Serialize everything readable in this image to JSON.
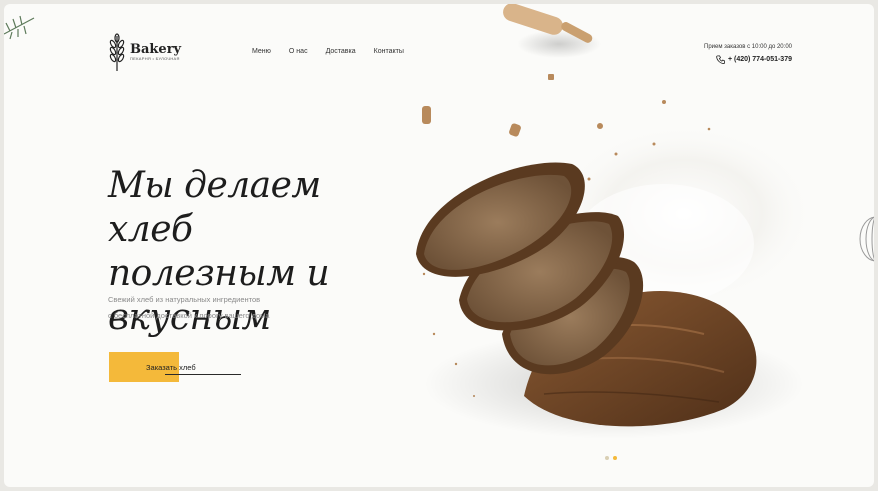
{
  "brand": {
    "name": "Bakery",
    "tagline": "ПЕКАРНЯ • БУЛОЧНАЯ"
  },
  "nav": {
    "items": [
      "Меню",
      "О нас",
      "Доставка",
      "Контакты"
    ]
  },
  "contact": {
    "hours": "Прием заказов с 10:00 до 20:00",
    "phone": "+ (420) 774-051-379"
  },
  "hero": {
    "headline_line1": "Мы делаем хлеб",
    "headline_line2": "полезным и вкусным",
    "sub_line1": "Свежий хлеб из натуральных ингредиентов",
    "sub_line2": "с бесплатной доставкой к порогу вашего дома",
    "cta_label": "Заказать хлеб"
  },
  "slider": {
    "count": 2,
    "active_index": 1
  },
  "colors": {
    "accent": "#f4b93a",
    "background": "#fbfbf9",
    "text": "#1d1d1d"
  }
}
